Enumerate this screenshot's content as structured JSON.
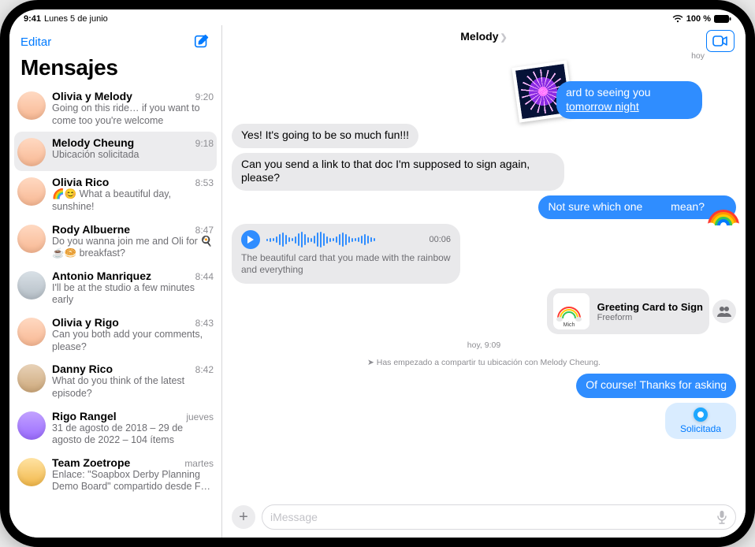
{
  "status_bar": {
    "time": "9:41",
    "date": "Lunes 5 de junio",
    "battery": "100 %"
  },
  "sidebar": {
    "edit_label": "Editar",
    "title": "Mensajes",
    "conversations": [
      {
        "name": "Olivia y Melody",
        "time": "9:20",
        "preview": "Going on this ride… if you want to come too you're welcome"
      },
      {
        "name": "Melody Cheung",
        "time": "9:18",
        "preview": "Ubicación solicitada"
      },
      {
        "name": "Olivia Rico",
        "time": "8:53",
        "preview": "🌈😊 What a beautiful day, sunshine!"
      },
      {
        "name": "Rody Albuerne",
        "time": "8:47",
        "preview": "Do you wanna join me and Oli for 🍳☕🥯 breakfast?"
      },
      {
        "name": "Antonio Manriquez",
        "time": "8:44",
        "preview": "I'll be at the studio a few minutes early"
      },
      {
        "name": "Olivia y Rigo",
        "time": "8:43",
        "preview": "Can you both add your comments, please?"
      },
      {
        "name": "Danny Rico",
        "time": "8:42",
        "preview": "What do you think of the latest episode?"
      },
      {
        "name": "Rigo Rangel",
        "time": "jueves",
        "preview": "31 de agosto de 2018 – 29 de agosto de 2022 – 104 ítems"
      },
      {
        "name": "Team Zoetrope",
        "time": "martes",
        "preview": "Enlace: \"Soapbox Derby Planning Demo Board\" compartido desde F…"
      }
    ]
  },
  "chat": {
    "title": "Melody",
    "placeholder": "iMessage",
    "messages": {
      "photo_timestamp": "hoy",
      "out1_prefix": "ard to seeing you ",
      "out1_link": "tomorrow night",
      "in1": "Yes! It's going to be so much fun!!!",
      "in2": "Can you send a link to that doc I'm supposed to sign again, please?",
      "out2_a": "Not sure which one",
      "out2_b": " mean?",
      "audio_duration": "00:06",
      "audio_caption": "The beautiful card that you made with the rainbow and everything",
      "att_title": "Greeting Card to Sign",
      "att_sub": "Freeform",
      "sys_time": "hoy, 9:09",
      "sys_loc": "Has empezado a compartir tu ubicación con Melody Cheung.",
      "out3": "Of course! Thanks for asking",
      "loc_label": "Solicitada"
    }
  }
}
